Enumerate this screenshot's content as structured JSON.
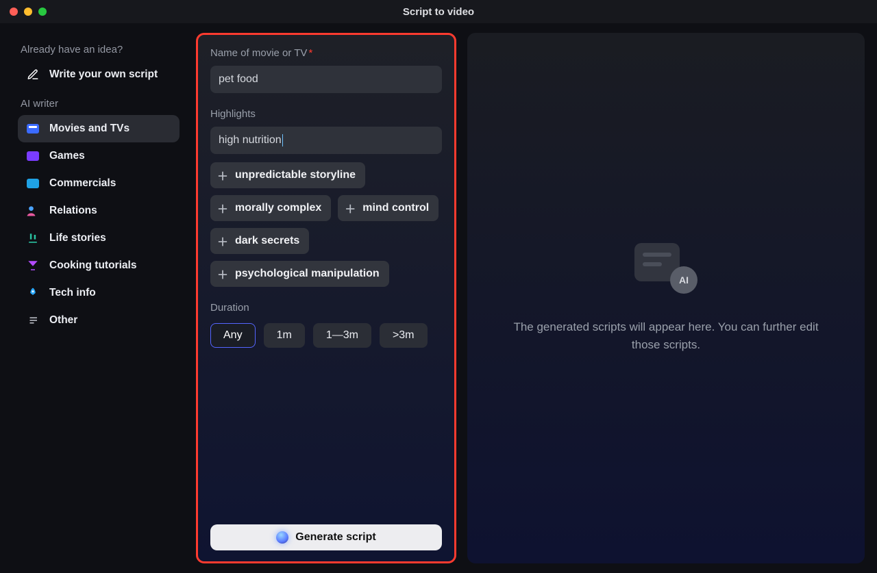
{
  "window": {
    "title": "Script to video"
  },
  "sidebar": {
    "headings": {
      "idea": "Already have an idea?",
      "ai": "AI writer"
    },
    "write_own": "Write your own script",
    "items": [
      {
        "label": "Movies and TVs",
        "active": true
      },
      {
        "label": "Games"
      },
      {
        "label": "Commercials"
      },
      {
        "label": "Relations"
      },
      {
        "label": "Life stories"
      },
      {
        "label": "Cooking tutorials"
      },
      {
        "label": "Tech info"
      },
      {
        "label": "Other"
      }
    ]
  },
  "form": {
    "name_label": "Name of movie or TV",
    "name_value": "pet food",
    "highlights_label": "Highlights",
    "highlights_value": "high nutrition",
    "suggestions": [
      "unpredictable storyline",
      "morally complex",
      "mind control",
      "dark secrets",
      "psychological manipulation"
    ],
    "duration_label": "Duration",
    "duration_options": [
      "Any",
      "1m",
      "1—3m",
      ">3m"
    ],
    "duration_selected": "Any",
    "generate_label": "Generate script"
  },
  "output": {
    "badge_text": "AI",
    "placeholder": "The generated scripts will appear here. You can further edit those scripts."
  }
}
